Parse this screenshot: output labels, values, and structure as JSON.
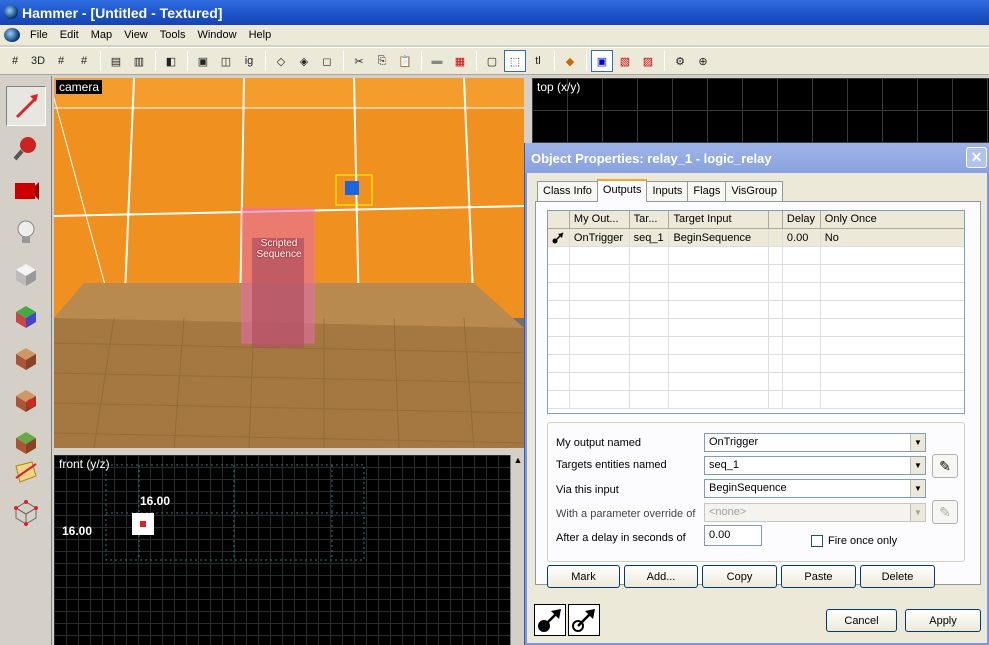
{
  "window": {
    "title": "Hammer - [Untitled - Textured]"
  },
  "menu": {
    "items": [
      "File",
      "Edit",
      "Map",
      "View",
      "Tools",
      "Window",
      "Help"
    ]
  },
  "toolbar": {
    "label_3d": "3D",
    "label_ig": "ig",
    "label_tl": "tl"
  },
  "viewports": {
    "camera": {
      "label": "camera",
      "entity_label": "Scripted Sequence"
    },
    "top": {
      "label": "top (x/y)"
    },
    "front": {
      "label": "front (y/z)",
      "dim_x": "16.00",
      "dim_y": "16.00"
    }
  },
  "dialog": {
    "title": "Object Properties: relay_1 - logic_relay",
    "tabs": [
      "Class Info",
      "Outputs",
      "Inputs",
      "Flags",
      "VisGroup"
    ],
    "active_tab": "Outputs",
    "grid": {
      "headers": [
        "",
        "My Out...",
        "Tar...",
        "Target Input",
        "",
        "Delay",
        "Only Once"
      ],
      "rows": [
        {
          "my_output": "OnTrigger",
          "target": "seq_1",
          "target_input": "BeginSequence",
          "delay": "0.00",
          "only_once": "No"
        }
      ]
    },
    "fields": {
      "output_label": "My output named",
      "output_value": "OnTrigger",
      "targets_label": "Targets entities named",
      "targets_value": "seq_1",
      "input_label": "Via this input",
      "input_value": "BeginSequence",
      "param_label": "With a parameter override of",
      "param_placeholder": "<none>",
      "delay_label": "After a delay in seconds of",
      "delay_value": "0.00",
      "fire_once_label": "Fire once only"
    },
    "buttons": {
      "mark": "Mark",
      "add": "Add...",
      "copy": "Copy",
      "paste": "Paste",
      "delete": "Delete",
      "cancel": "Cancel",
      "apply": "Apply"
    }
  },
  "colors": {
    "title_blue": "#1c52c8",
    "orange_wall": "#f09020",
    "trigger_floor": "#b88a50"
  }
}
